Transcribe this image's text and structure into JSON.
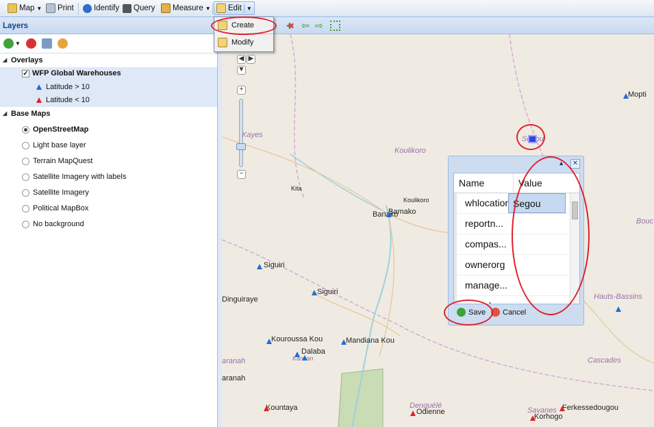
{
  "toolbar": {
    "map": "Map",
    "print": "Print",
    "identify": "Identify",
    "query": "Query",
    "measure": "Measure",
    "edit": "Edit"
  },
  "edit_menu": {
    "create": "Create",
    "modify": "Modify"
  },
  "layers": {
    "title": "Layers",
    "overlays": "Overlays",
    "warehouses": "WFP Global Warehouses",
    "legend_high": "Latitude > 10",
    "legend_low": "Latitude < 10",
    "base_maps": "Base Maps",
    "base": [
      "OpenStreetMap",
      "Light base layer",
      "Terrain MapQuest",
      "Satellite Imagery with labels",
      "Satellite Imagery",
      "Political MapBox",
      "No background"
    ],
    "selected_base": "OpenStreetMap"
  },
  "popup": {
    "col_name": "Name",
    "col_value": "Value",
    "rows": [
      {
        "name": "whlocation",
        "value": "Segou"
      },
      {
        "name": "reportn...",
        "value": ""
      },
      {
        "name": "compas...",
        "value": ""
      },
      {
        "name": "ownerorg",
        "value": ""
      },
      {
        "name": "manage...",
        "value": ""
      },
      {
        "name": "pumpby",
        "value": ""
      }
    ],
    "save": "Save",
    "cancel": "Cancel"
  },
  "map_labels": {
    "mopti": "Mopti",
    "segou": "Segou",
    "kayes": "Kayes",
    "koulikoro": "Koulikoro",
    "kita": "Kita",
    "koulikoro_town": "Koulikoro",
    "bamako": "Bamako",
    "banako": "Banako",
    "bouc": "Bouc",
    "siguiri1": "Siguiri",
    "siguiri2": "Siguiri",
    "dinguiraye": "Dinguiraye",
    "hauts_bassins": "Hauts-Bassins",
    "kouroussa": "Kouroussa Kou",
    "mandiana": "Mandiana Kou",
    "dalaba": "Dalaba",
    "kankan": "Kankan",
    "ranah": "aranah",
    "faranah": "aranah",
    "cascades": "Cascades",
    "kountaya": "Kountaya",
    "denguele": "Denguélé",
    "odienne": "Odienne",
    "savanes": "Savanes",
    "ferke": "Ferkessedougou",
    "korhogo": "Korhogo"
  },
  "colors": {
    "accent": "#15428b",
    "highlight_ring": "#e0202a",
    "marker_high": "#1e6cd6",
    "marker_low": "#dd2222"
  }
}
